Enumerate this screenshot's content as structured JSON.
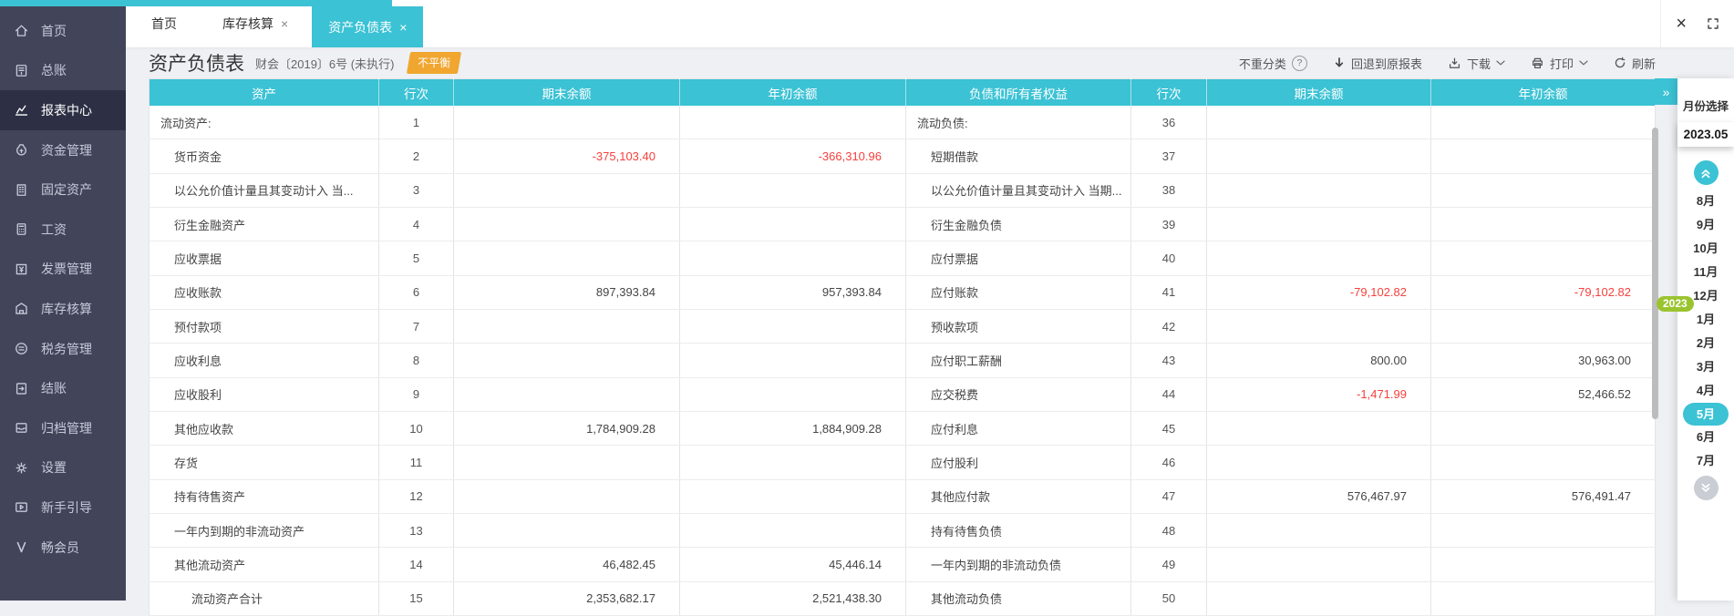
{
  "tabs": [
    {
      "label": "首页",
      "closable": false,
      "active": false
    },
    {
      "label": "库存核算",
      "closable": true,
      "active": false
    },
    {
      "label": "资产负债表",
      "closable": true,
      "active": true
    }
  ],
  "sidebar": {
    "items": [
      {
        "label": "首页",
        "icon": "home",
        "active": false
      },
      {
        "label": "总账",
        "icon": "ledger",
        "active": false
      },
      {
        "label": "报表中心",
        "icon": "report",
        "active": true
      },
      {
        "label": "资金管理",
        "icon": "funds",
        "active": false
      },
      {
        "label": "固定资产",
        "icon": "building",
        "active": false
      },
      {
        "label": "工资",
        "icon": "calc",
        "active": false
      },
      {
        "label": "发票管理",
        "icon": "invoice",
        "active": false
      },
      {
        "label": "库存核算",
        "icon": "warehouse",
        "active": false
      },
      {
        "label": "税务管理",
        "icon": "tax",
        "active": false
      },
      {
        "label": "结账",
        "icon": "book",
        "active": false
      },
      {
        "label": "归档管理",
        "icon": "archive",
        "active": false
      },
      {
        "label": "设置",
        "icon": "gear",
        "active": false
      },
      {
        "label": "新手引导",
        "icon": "play",
        "active": false
      },
      {
        "label": "畅会员",
        "icon": "vip",
        "active": false
      }
    ]
  },
  "page": {
    "title": "资产负债表",
    "subtitle": "财会〔2019〕6号 (未执行)",
    "status_badge": "不平衡"
  },
  "toolbar": {
    "reclassify": "不重分类",
    "revert": "回退到原报表",
    "download": "下载",
    "print": "打印",
    "refresh": "刷新"
  },
  "table": {
    "headers": [
      "资产",
      "行次",
      "期末余额",
      "年初余额",
      "负债和所有者权益",
      "行次",
      "期末余额",
      "年初余额"
    ],
    "rows": [
      {
        "asset": "流动资产:",
        "ai": 0,
        "line": "1",
        "end": "",
        "begin": "",
        "liab": "流动负债:",
        "li": 0,
        "lline": "36",
        "lend": "",
        "lbegin": ""
      },
      {
        "asset": "货币资金",
        "ai": 1,
        "line": "2",
        "end": "-375,103.40",
        "begin": "-366,310.96",
        "liab": "短期借款",
        "li": 1,
        "lline": "37",
        "lend": "",
        "lbegin": ""
      },
      {
        "asset": "以公允价值计量且其变动计入 当...",
        "ai": 1,
        "line": "3",
        "end": "",
        "begin": "",
        "liab": "以公允价值计量且其变动计入 当期...",
        "li": 1,
        "lline": "38",
        "lend": "",
        "lbegin": ""
      },
      {
        "asset": "衍生金融资产",
        "ai": 1,
        "line": "4",
        "end": "",
        "begin": "",
        "liab": "衍生金融负债",
        "li": 1,
        "lline": "39",
        "lend": "",
        "lbegin": ""
      },
      {
        "asset": "应收票据",
        "ai": 1,
        "line": "5",
        "end": "",
        "begin": "",
        "liab": "应付票据",
        "li": 1,
        "lline": "40",
        "lend": "",
        "lbegin": ""
      },
      {
        "asset": "应收账款",
        "ai": 1,
        "line": "6",
        "end": "897,393.84",
        "begin": "957,393.84",
        "liab": "应付账款",
        "li": 1,
        "lline": "41",
        "lend": "-79,102.82",
        "lbegin": "-79,102.82"
      },
      {
        "asset": "预付款项",
        "ai": 1,
        "line": "7",
        "end": "",
        "begin": "",
        "liab": "预收款项",
        "li": 1,
        "lline": "42",
        "lend": "",
        "lbegin": ""
      },
      {
        "asset": "应收利息",
        "ai": 1,
        "line": "8",
        "end": "",
        "begin": "",
        "liab": "应付职工薪酬",
        "li": 1,
        "lline": "43",
        "lend": "800.00",
        "lbegin": "30,963.00"
      },
      {
        "asset": "应收股利",
        "ai": 1,
        "line": "9",
        "end": "",
        "begin": "",
        "liab": "应交税费",
        "li": 1,
        "lline": "44",
        "lend": "-1,471.99",
        "lbegin": "52,466.52"
      },
      {
        "asset": "其他应收款",
        "ai": 1,
        "line": "10",
        "end": "1,784,909.28",
        "begin": "1,884,909.28",
        "liab": "应付利息",
        "li": 1,
        "lline": "45",
        "lend": "",
        "lbegin": ""
      },
      {
        "asset": "存货",
        "ai": 1,
        "line": "11",
        "end": "",
        "begin": "",
        "liab": "应付股利",
        "li": 1,
        "lline": "46",
        "lend": "",
        "lbegin": ""
      },
      {
        "asset": "持有待售资产",
        "ai": 1,
        "line": "12",
        "end": "",
        "begin": "",
        "liab": "其他应付款",
        "li": 1,
        "lline": "47",
        "lend": "576,467.97",
        "lbegin": "576,491.47"
      },
      {
        "asset": "一年内到期的非流动资产",
        "ai": 1,
        "line": "13",
        "end": "",
        "begin": "",
        "liab": "持有待售负债",
        "li": 1,
        "lline": "48",
        "lend": "",
        "lbegin": ""
      },
      {
        "asset": "其他流动资产",
        "ai": 1,
        "line": "14",
        "end": "46,482.45",
        "begin": "45,446.14",
        "liab": "一年内到期的非流动负债",
        "li": 1,
        "lline": "49",
        "lend": "",
        "lbegin": ""
      },
      {
        "asset": "流动资产合计",
        "ai": 2,
        "line": "15",
        "end": "2,353,682.17",
        "begin": "2,521,438.30",
        "liab": "其他流动负债",
        "li": 1,
        "lline": "50",
        "lend": "",
        "lbegin": ""
      }
    ]
  },
  "month_panel": {
    "title": "月份选择",
    "current_period": "2023.05",
    "year_badge": "2023",
    "months": [
      "8月",
      "9月",
      "10月",
      "11月",
      "12月",
      "1月",
      "2月",
      "3月",
      "4月",
      "5月",
      "6月",
      "7月"
    ],
    "selected_month": "5月"
  },
  "expander_glyph": "»",
  "colors": {
    "accent": "#3bc2d4",
    "sidebar_bg": "#42455a",
    "sidebar_active_bg": "#2d3044",
    "negative_value": "#f5413d",
    "status_badge_bg": "#f0a62f",
    "year_badge_bg": "#9ac42f"
  }
}
